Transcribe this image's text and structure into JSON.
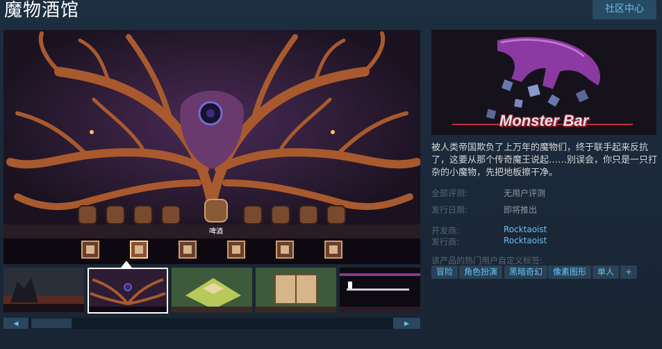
{
  "header": {
    "title": "魔物酒馆",
    "community_button": "社区中心"
  },
  "media": {
    "current_item_label": "啤酒",
    "scroll_left": "◀",
    "scroll_right": "▶"
  },
  "capsule": {
    "logo_text": "Monster Bar"
  },
  "info": {
    "description": "被人类帝国欺负了上万年的魔物们，终于联手起来反抗了，这要从那个传奇魔王说起……别误会，你只是一只打杂的小魔物，先把地板擦干净。",
    "reviews_label": "全部评测:",
    "reviews_value": "无用户评测",
    "release_label": "发行日期:",
    "release_value": "即将推出",
    "developer_label": "开发商:",
    "developer_value": "Rocktaoist",
    "publisher_label": "发行商:",
    "publisher_value": "Rocktaoist",
    "tags_label": "该产品的热门用户自定义标签:",
    "tags": [
      "冒险",
      "角色扮演",
      "黑暗奇幻",
      "像素图形",
      "单人",
      "+"
    ]
  },
  "colors": {
    "accent": "#66c0f4",
    "tag_bg": "#2b4256",
    "button_bg": "#264b63"
  }
}
